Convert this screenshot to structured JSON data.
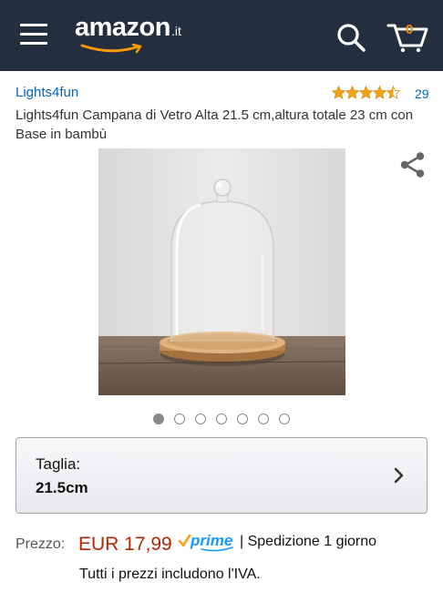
{
  "header": {
    "logo_text": "amazon",
    "logo_tld": ".it",
    "cart_count": "0",
    "colors": {
      "bar": "#232f3e",
      "accent": "#f08804"
    },
    "icons": [
      "menu-icon",
      "search-icon",
      "cart-icon"
    ]
  },
  "product": {
    "brand": "Lights4fun",
    "rating_stars": 4.5,
    "rating_count": "29",
    "title": "Lights4fun Campana di Vetro Alta 21.5 cm,altura totale 23 cm con Base in bambù",
    "image_count": 7,
    "active_image_index": 0
  },
  "size_selector": {
    "label": "Taglia:",
    "value": "21.5cm"
  },
  "price": {
    "label": "Prezzo:",
    "value": "EUR 17,99",
    "prime_label": "prime",
    "shipping": "| Spedizione 1 giorno",
    "vat_note": "Tutti i prezzi includono l'IVA."
  }
}
